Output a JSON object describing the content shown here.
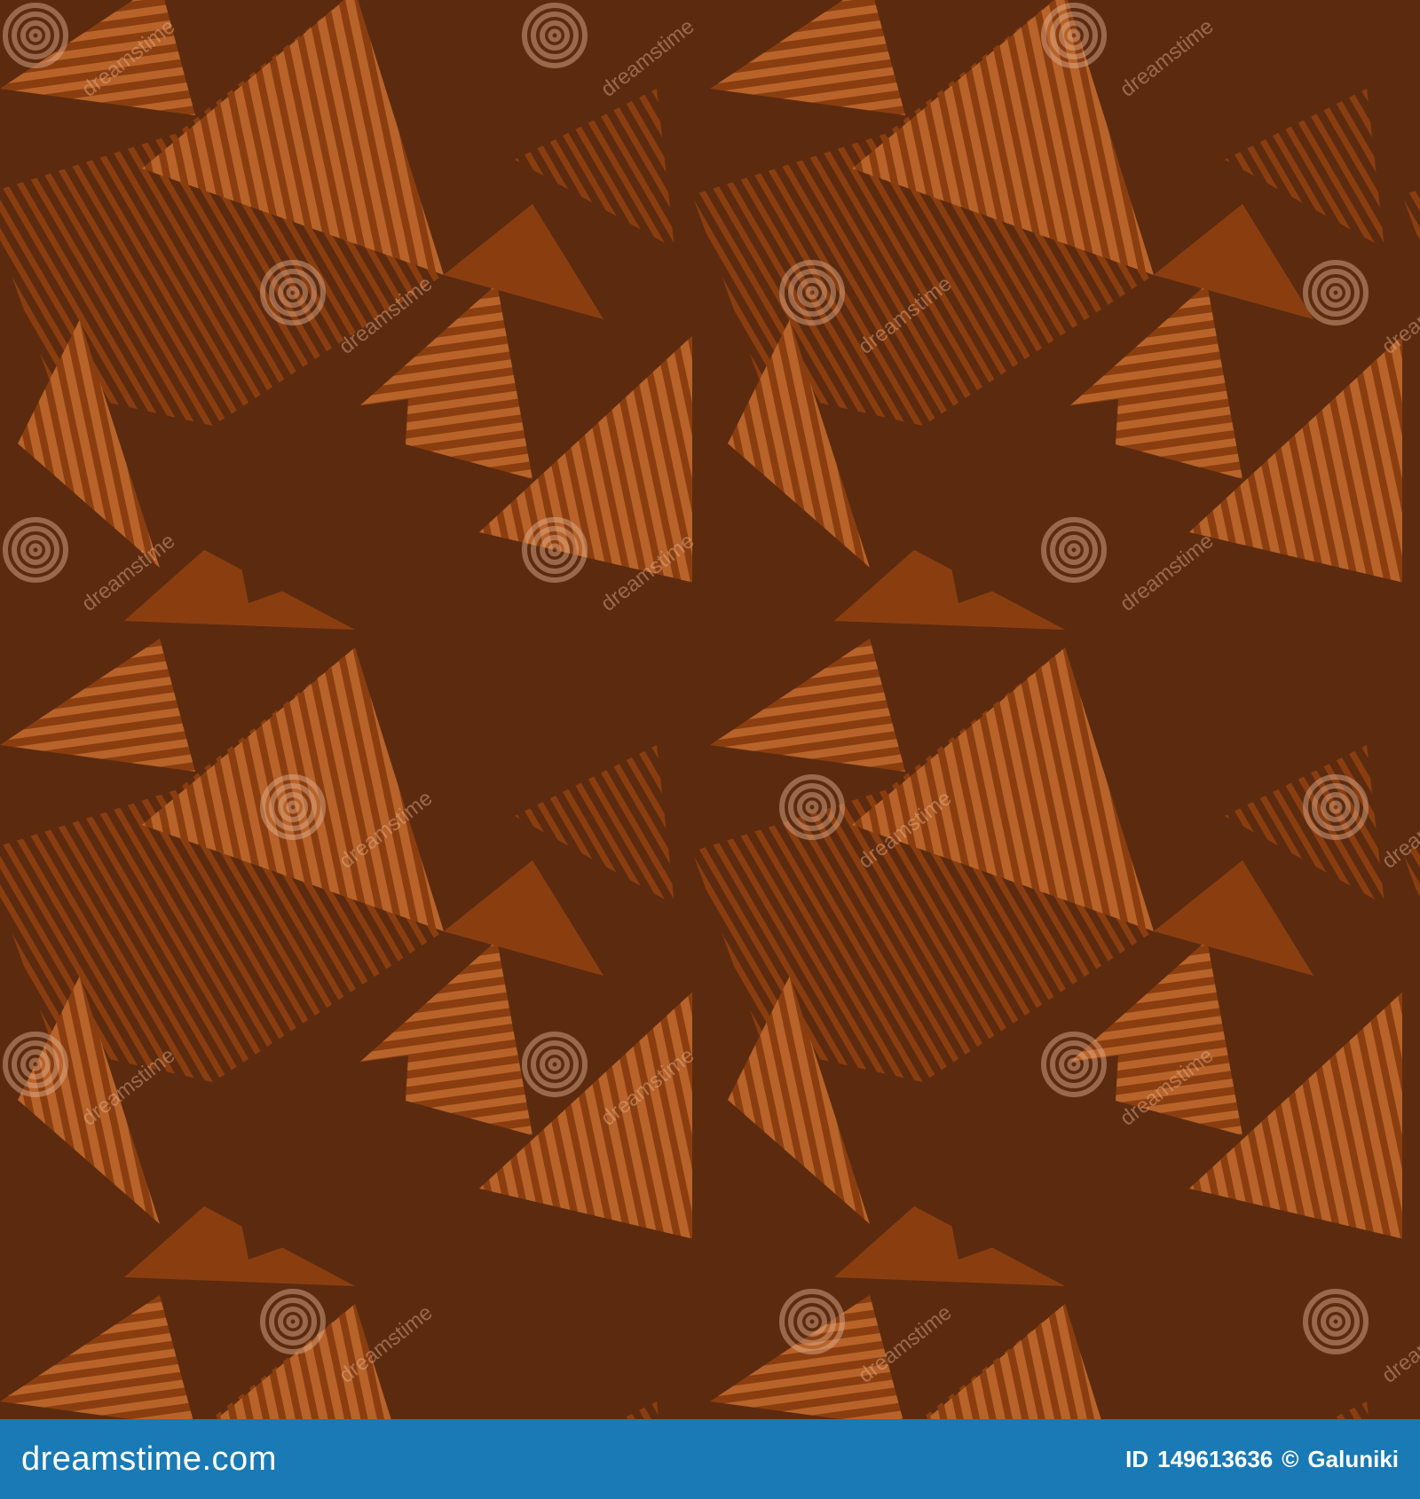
{
  "footer": {
    "site_name": "dreamstime.com",
    "id_label": "ID",
    "image_id": "149613636",
    "copyright_symbol": "©",
    "author": "Galuniki"
  },
  "watermark": {
    "text": "dreamstime",
    "icon": "spiral-logo-icon"
  },
  "colors": {
    "dark_brown": "#5c2b0f",
    "mid_brown": "#8a3e10",
    "light_copper": "#b8632a",
    "footer_bar": "#1a7ab5",
    "footer_text": "#ffffff"
  }
}
